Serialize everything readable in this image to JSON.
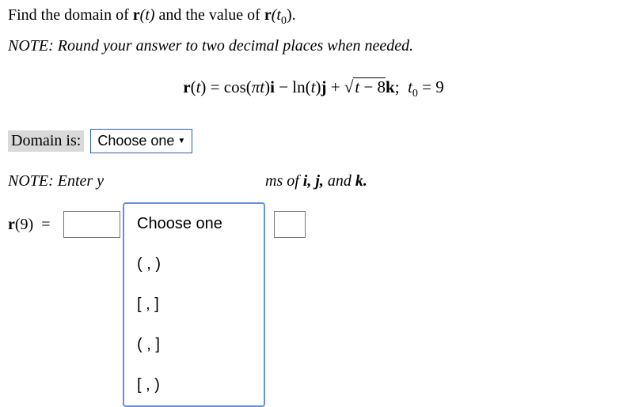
{
  "problem": {
    "line1_before": "Find the domain of ",
    "line1_rt": "r",
    "line1_rt_arg": "(t)",
    "line1_mid": " and the value of ",
    "line1_rt0": "r",
    "line1_rt0_arg": "(t",
    "line1_rt0_sub": "0",
    "line1_rt0_close": ").",
    "note": "NOTE:  Round your answer to two decimal places when needed."
  },
  "equation": {
    "text": "r(t) = cos(πt)i − ln(t)j + √(t − 8)k;  t0 = 9"
  },
  "domain": {
    "label": "Domain is:",
    "select_text": "Choose one"
  },
  "dropdown": {
    "items": [
      "Choose one",
      "( , )",
      "[ , ]",
      "( , ]",
      "[ , )"
    ]
  },
  "note2": {
    "before": "NOTE:  Enter y",
    "after_part1": "ms of ",
    "after_ijk": "i, j,",
    "after_and": " and ",
    "after_k": "k."
  },
  "r9": {
    "label_r": "r",
    "label_arg": "(9)",
    "equals": "="
  }
}
